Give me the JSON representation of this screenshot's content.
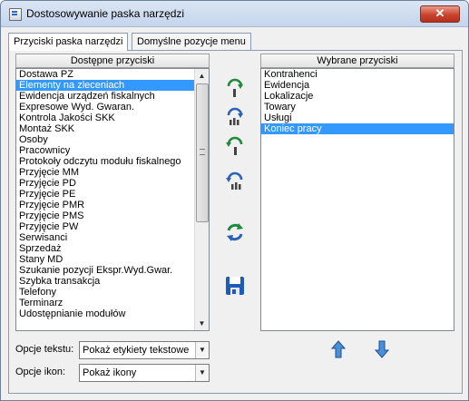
{
  "window": {
    "title": "Dostosowywanie paska narzędzi",
    "close_symbol": "✕"
  },
  "tabs": [
    {
      "label": "Przyciski paska narzędzi",
      "active": true
    },
    {
      "label": "Domyślne pozycje menu",
      "active": false
    }
  ],
  "available": {
    "header": "Dostępne przyciski",
    "items": [
      "Dostawa PZ",
      "Elementy na zleceniach",
      "Ewidencja urządzeń fiskalnych",
      "Expresowe Wyd. Gwaran.",
      "Kontrola Jakości SKK",
      "Montaż SKK",
      "Osoby",
      "Pracownicy",
      "Protokoły odczytu modułu fiskalnego",
      "Przyjęcie MM",
      "Przyjęcie PD",
      "Przyjęcie PE",
      "Przyjęcie PMR",
      "Przyjęcie PMS",
      "Przyjęcie PW",
      "Serwisanci",
      "Sprzedaż",
      "Stany MD",
      "Szukanie pozycji Ekspr.Wyd.Gwar.",
      "Szybka transakcja",
      "Telefony",
      "Terminarz",
      "Udostępnianie modułów"
    ],
    "selected_index": 1
  },
  "chosen": {
    "header": "Wybrane przyciski",
    "items": [
      "Kontrahenci",
      "Ewidencja",
      "Lokalizacje",
      "Towary",
      "Usługi",
      "Koniec pracy"
    ],
    "selected_index": 5
  },
  "options": {
    "text_label": "Opcje tekstu:",
    "text_value": "Pokaż etykiety tekstowe",
    "icon_label": "Opcje ikon:",
    "icon_value": "Pokaż ikony"
  },
  "colors": {
    "selection": "#3399ff",
    "icon_green": "#1f8a3b",
    "icon_blue": "#2a63b8"
  }
}
